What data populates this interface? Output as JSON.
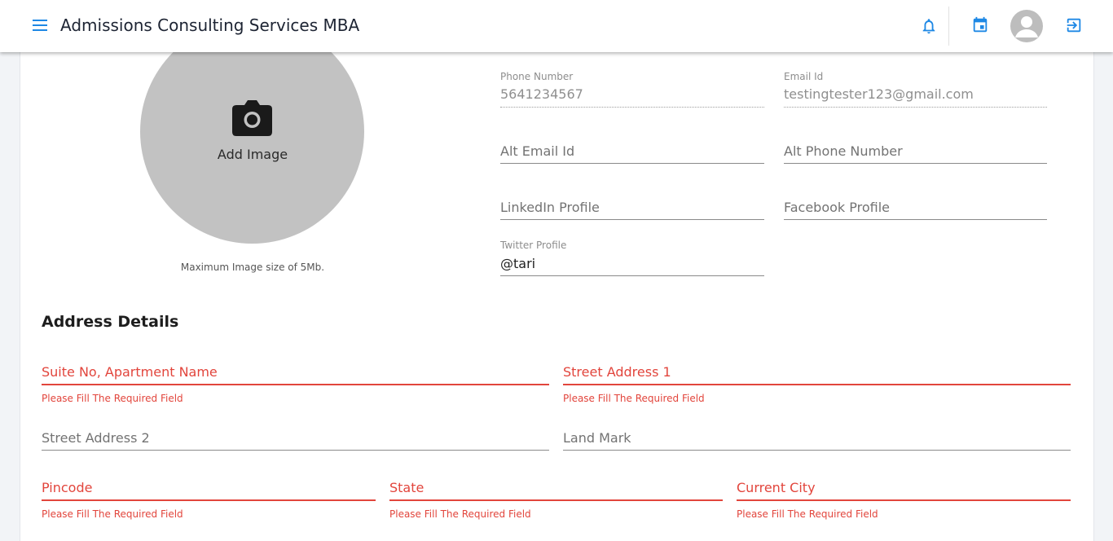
{
  "header": {
    "title": "Admissions Consulting Services MBA",
    "icons": {
      "menu": "menu-icon",
      "notifications": "bell-icon",
      "calendar": "calendar-icon",
      "profile": "account-circle-icon",
      "logout": "logout-icon"
    },
    "accent_color": "#1e88e5"
  },
  "profile_image": {
    "add_label": "Add Image",
    "note": "Maximum Image size of 5Mb.",
    "icon": "camera-icon"
  },
  "contact": {
    "phone": {
      "label": "Phone Number",
      "value": "5641234567"
    },
    "email": {
      "label": "Email Id",
      "value": "testingtester123@gmail.com"
    },
    "alt_email": {
      "placeholder": "Alt Email Id"
    },
    "alt_phone": {
      "placeholder": "Alt Phone Number"
    },
    "linkedin": {
      "placeholder": "LinkedIn Profile"
    },
    "facebook": {
      "placeholder": "Facebook Profile"
    },
    "twitter": {
      "label": "Twitter Profile",
      "value": "@tari"
    }
  },
  "address": {
    "title": "Address Details",
    "error_message": "Please Fill The Required Field",
    "error_color": "#e2453c",
    "suite": {
      "placeholder": "Suite No, Apartment Name"
    },
    "street1": {
      "placeholder": "Street Address 1"
    },
    "street2": {
      "placeholder": "Street Address 2"
    },
    "landmark": {
      "placeholder": "Land Mark"
    },
    "pincode": {
      "placeholder": "Pincode"
    },
    "state": {
      "placeholder": "State"
    },
    "city": {
      "placeholder": "Current City"
    }
  }
}
